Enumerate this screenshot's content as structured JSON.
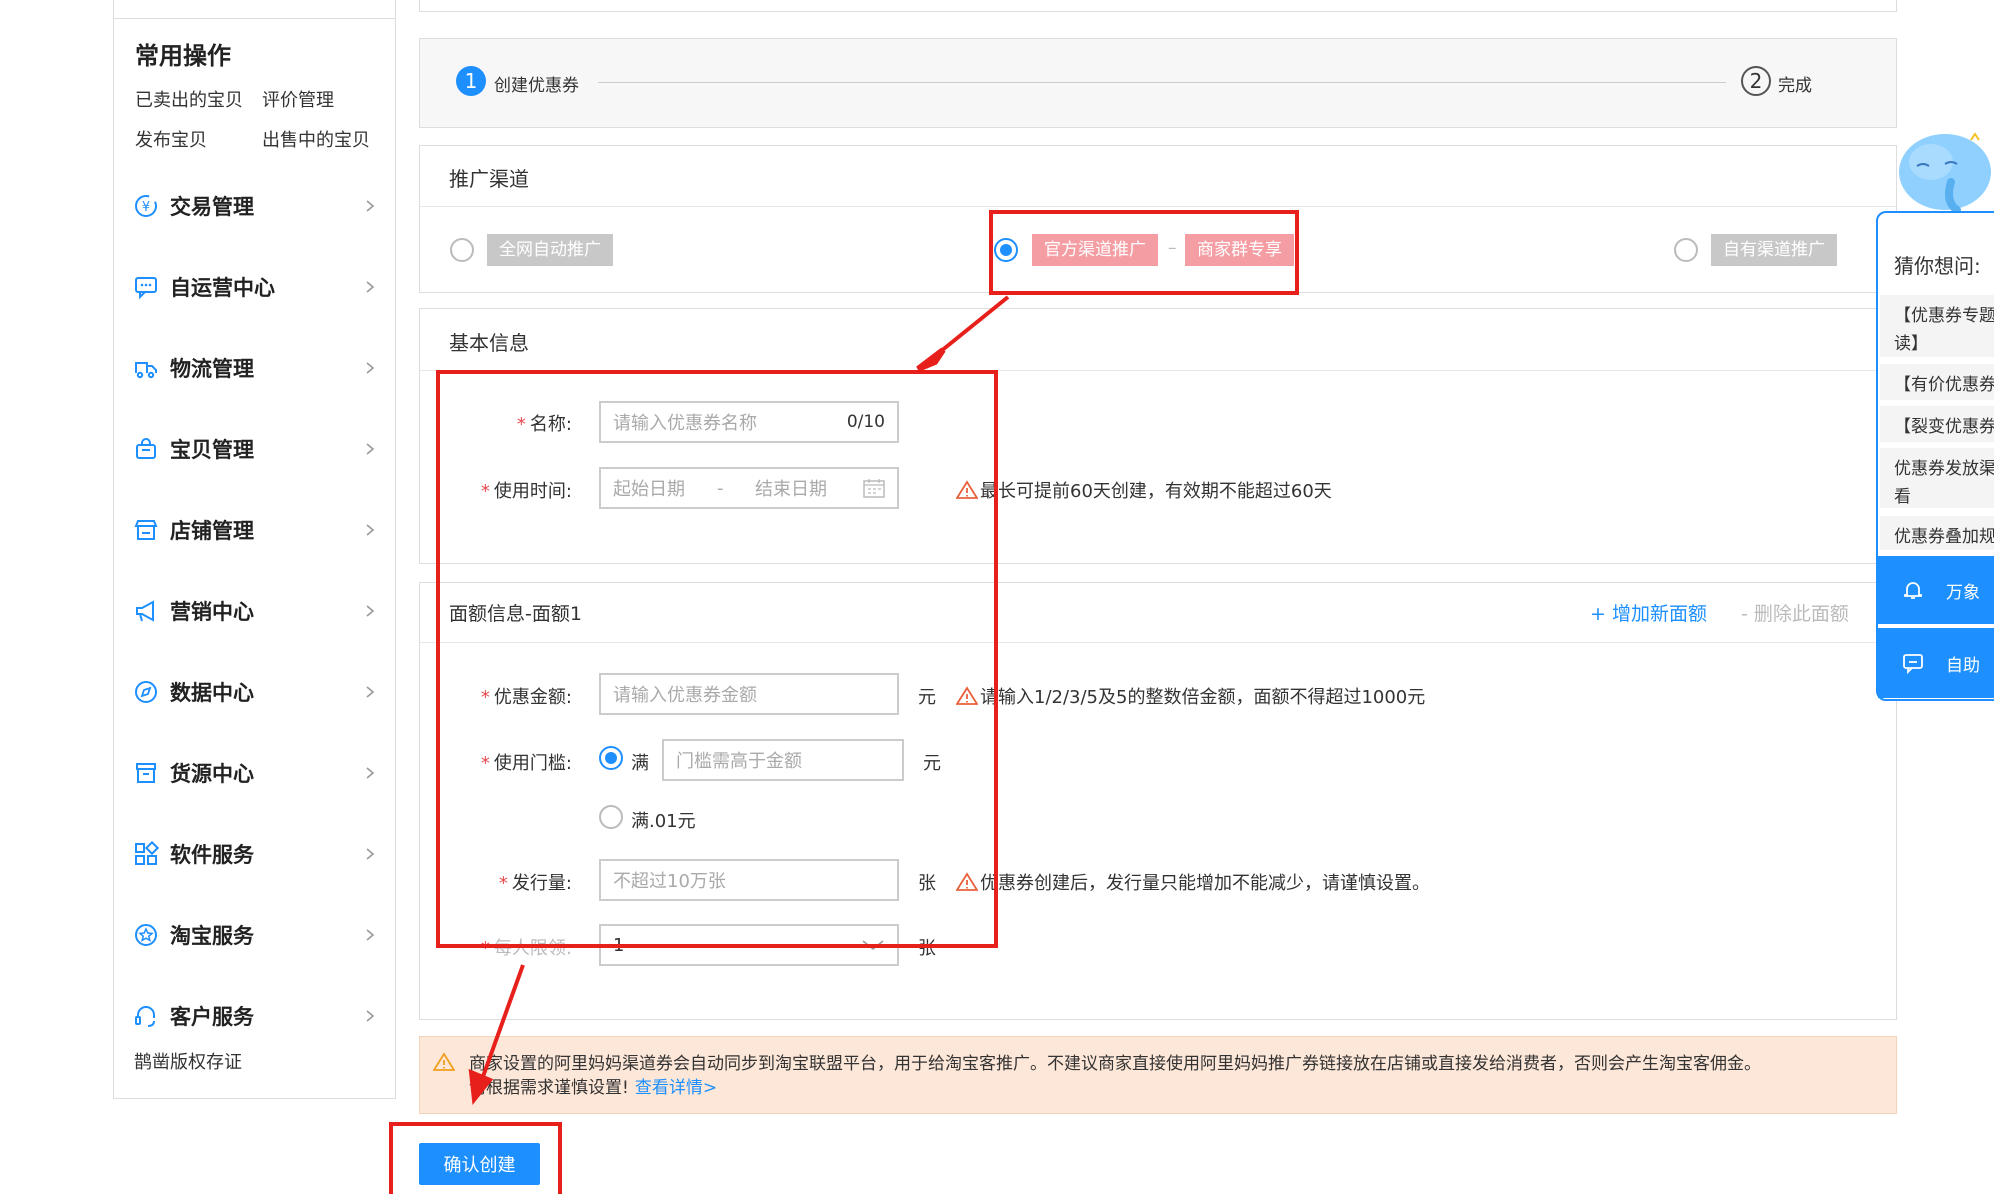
{
  "sidebar": {
    "common_title": "常用操作",
    "quick_links": [
      "已卖出的宝贝",
      "评价管理",
      "发布宝贝",
      "出售中的宝贝"
    ],
    "menu": [
      {
        "label": "交易管理",
        "icon": "yen-icon"
      },
      {
        "label": "自运营中心",
        "icon": "chat-bubble-icon"
      },
      {
        "label": "物流管理",
        "icon": "truck-icon"
      },
      {
        "label": "宝贝管理",
        "icon": "bag-icon"
      },
      {
        "label": "店铺管理",
        "icon": "store-icon"
      },
      {
        "label": "营销中心",
        "icon": "megaphone-icon"
      },
      {
        "label": "数据中心",
        "icon": "compass-icon"
      },
      {
        "label": "货源中心",
        "icon": "box-icon"
      },
      {
        "label": "软件服务",
        "icon": "apps-grid-icon"
      },
      {
        "label": "淘宝服务",
        "icon": "star-circle-icon"
      },
      {
        "label": "客户服务",
        "icon": "headset-icon"
      }
    ],
    "footer": "鹊凿版权存证"
  },
  "steps": {
    "step1_num": "1",
    "step1_label": "创建优惠券",
    "step2_num": "2",
    "step2_label": "完成"
  },
  "channel": {
    "title": "推广渠道",
    "options": [
      {
        "label": "全网自动推广",
        "selected": false
      },
      {
        "label": "官方渠道推广",
        "sub_label": "商家群专享",
        "separator": "–",
        "selected": true
      },
      {
        "label": "自有渠道推广",
        "selected": false
      }
    ]
  },
  "basic": {
    "title": "基本信息",
    "name_label": "名称:",
    "name_placeholder": "请输入优惠券名称",
    "name_count": "0/10",
    "time_label": "使用时间:",
    "start_placeholder": "起始日期",
    "date_sep": "-",
    "end_placeholder": "结束日期",
    "time_hint": "最长可提前60天创建，有效期不能超过60天"
  },
  "amount": {
    "title": "面额信息-面额1",
    "add_link": "+ 增加新面额",
    "delete_link": "- 删除此面额",
    "value_label": "优惠金额:",
    "value_placeholder": "请输入优惠券金额",
    "value_unit": "元",
    "value_hint": "请输入1/2/3/5及5的整数倍金额，面额不得超过1000元",
    "threshold_label": "使用门槛:",
    "threshold_opt1": "满",
    "threshold_placeholder": "门槛需高于金额",
    "threshold_unit": "元",
    "threshold_opt2": "满.01元",
    "qty_label": "发行量:",
    "qty_placeholder": "不超过10万张",
    "qty_unit": "张",
    "qty_hint": "优惠券创建后，发行量只能增加不能减少，请谨慎设置。",
    "limit_label": "每人限领:",
    "limit_value": "1",
    "limit_unit": "张"
  },
  "notice": {
    "text1": "商家设置的阿里妈妈渠道券会自动同步到淘宝联盟平台，用于给淘宝客推广。不建议商家直接使用阿里妈妈推广券链接放在店铺或直接发给消费者，否则会产生淘宝客佣金。",
    "text2": "请根据需求谨慎设置!",
    "link": "查看详情>"
  },
  "submit": {
    "label": "确认创建"
  },
  "chat": {
    "title": "猜你想问:",
    "items": [
      "【优惠券专题",
      "读】",
      "【有价优惠券",
      "【裂变优惠券",
      "优惠券发放渠",
      "看",
      "优惠券叠加规"
    ],
    "btn1": "万象",
    "btn2": "自助"
  },
  "colors": {
    "accent": "#1d8ffe",
    "annotation_red": "#e8201c",
    "tag_pink": "#f49ea4"
  }
}
